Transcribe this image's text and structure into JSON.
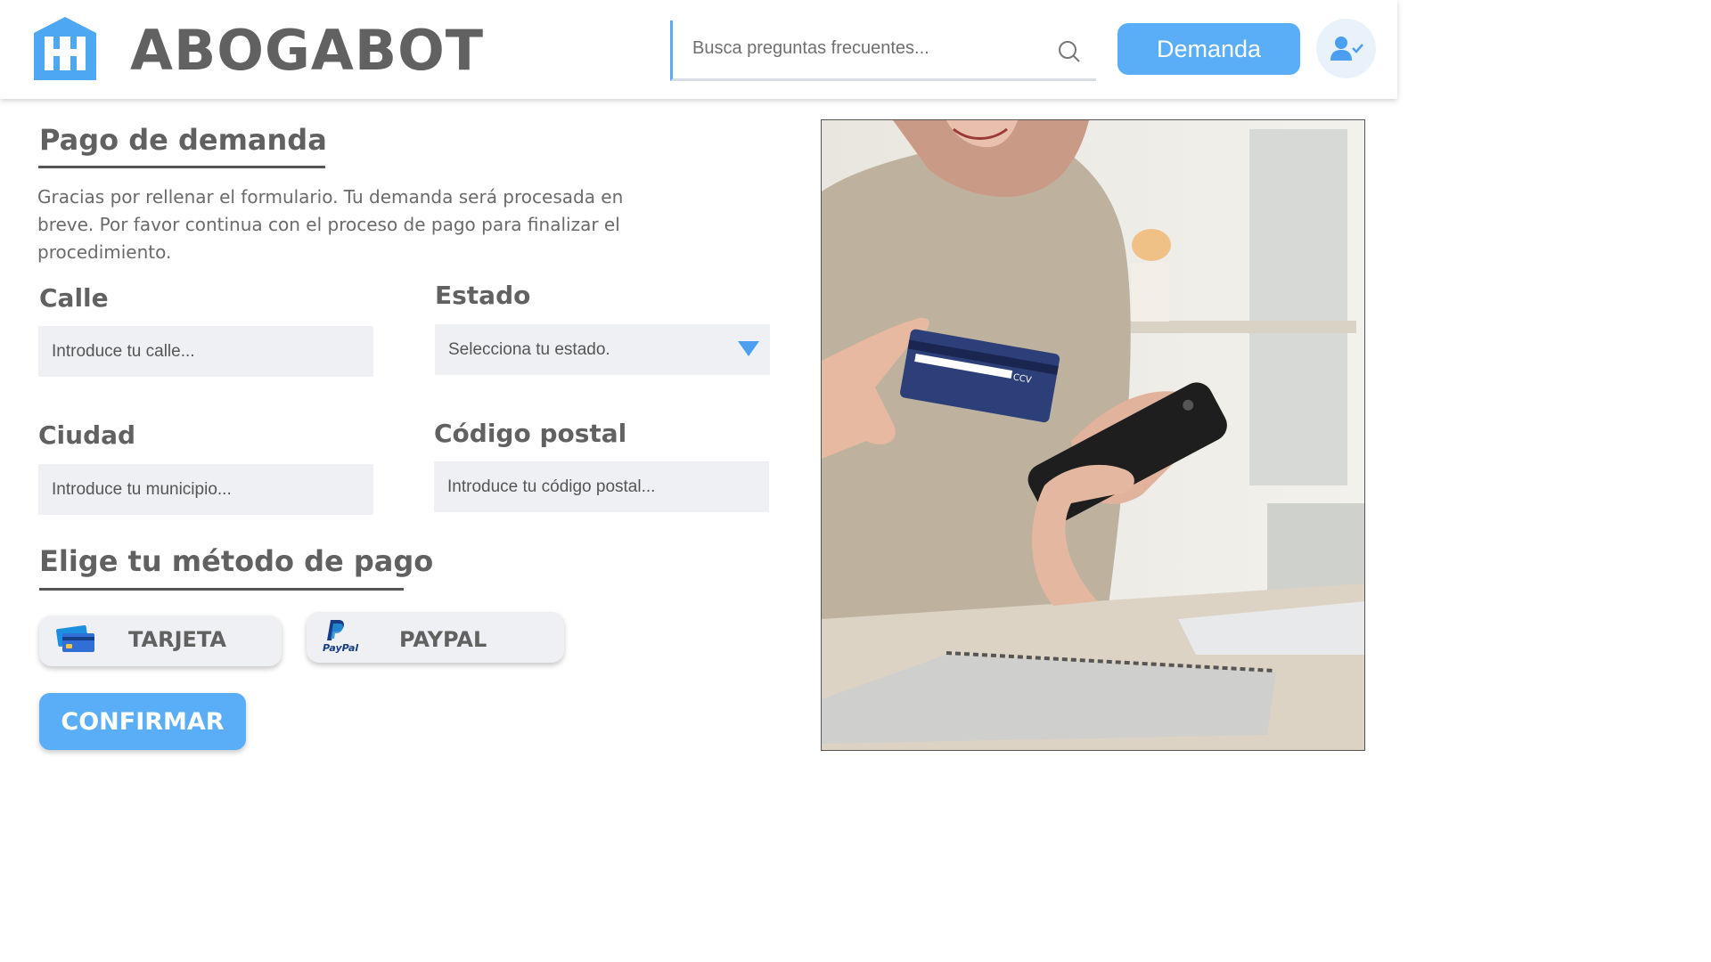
{
  "header": {
    "brand": "ABOGABOT",
    "search_placeholder": "Busca preguntas frecuentes...",
    "demand_button": "Demanda",
    "accent_color": "#5aadf7"
  },
  "main": {
    "title": "Pago de demanda",
    "intro": "Gracias por rellenar el formulario. Tu demanda será procesada en breve. Por favor continua con el proceso de pago para finalizar el procedimiento.",
    "fields": {
      "street": {
        "label": "Calle",
        "placeholder": "Introduce tu calle..."
      },
      "state": {
        "label": "Estado",
        "value": "Selecciona tu estado."
      },
      "city": {
        "label": "Ciudad",
        "placeholder": "Introduce tu municipio..."
      },
      "postal": {
        "label": "Código postal",
        "placeholder": "Introduce tu código postal..."
      }
    },
    "payment": {
      "title": "Elige tu método de pago",
      "card_label": "TARJETA",
      "paypal_label": "PAYPAL",
      "paypal_logo_text": "PayPal"
    },
    "confirm_button": "CONFIRMAR"
  },
  "photo": {
    "card_text": "CCV"
  }
}
